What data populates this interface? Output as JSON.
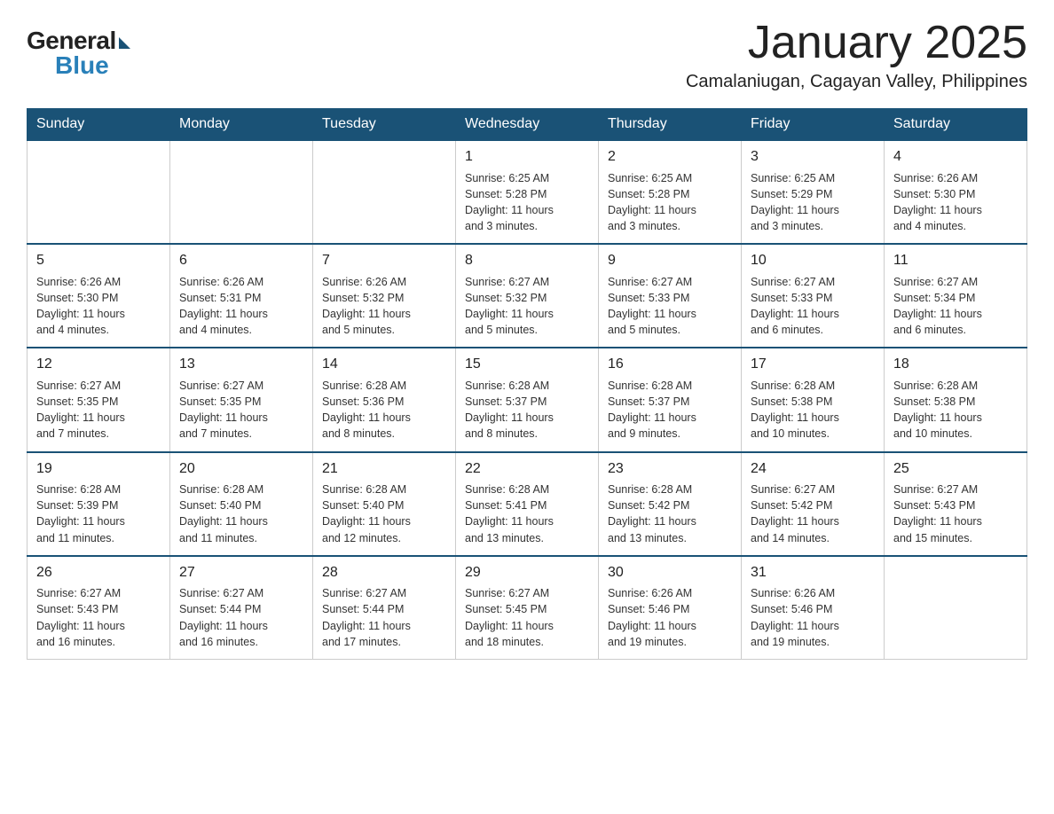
{
  "header": {
    "logo": {
      "general": "General",
      "blue": "Blue"
    },
    "title": "January 2025",
    "subtitle": "Camalaniugan, Cagayan Valley, Philippines"
  },
  "weekdays": [
    "Sunday",
    "Monday",
    "Tuesday",
    "Wednesday",
    "Thursday",
    "Friday",
    "Saturday"
  ],
  "weeks": [
    [
      {
        "day": "",
        "info": ""
      },
      {
        "day": "",
        "info": ""
      },
      {
        "day": "",
        "info": ""
      },
      {
        "day": "1",
        "info": "Sunrise: 6:25 AM\nSunset: 5:28 PM\nDaylight: 11 hours\nand 3 minutes."
      },
      {
        "day": "2",
        "info": "Sunrise: 6:25 AM\nSunset: 5:28 PM\nDaylight: 11 hours\nand 3 minutes."
      },
      {
        "day": "3",
        "info": "Sunrise: 6:25 AM\nSunset: 5:29 PM\nDaylight: 11 hours\nand 3 minutes."
      },
      {
        "day": "4",
        "info": "Sunrise: 6:26 AM\nSunset: 5:30 PM\nDaylight: 11 hours\nand 4 minutes."
      }
    ],
    [
      {
        "day": "5",
        "info": "Sunrise: 6:26 AM\nSunset: 5:30 PM\nDaylight: 11 hours\nand 4 minutes."
      },
      {
        "day": "6",
        "info": "Sunrise: 6:26 AM\nSunset: 5:31 PM\nDaylight: 11 hours\nand 4 minutes."
      },
      {
        "day": "7",
        "info": "Sunrise: 6:26 AM\nSunset: 5:32 PM\nDaylight: 11 hours\nand 5 minutes."
      },
      {
        "day": "8",
        "info": "Sunrise: 6:27 AM\nSunset: 5:32 PM\nDaylight: 11 hours\nand 5 minutes."
      },
      {
        "day": "9",
        "info": "Sunrise: 6:27 AM\nSunset: 5:33 PM\nDaylight: 11 hours\nand 5 minutes."
      },
      {
        "day": "10",
        "info": "Sunrise: 6:27 AM\nSunset: 5:33 PM\nDaylight: 11 hours\nand 6 minutes."
      },
      {
        "day": "11",
        "info": "Sunrise: 6:27 AM\nSunset: 5:34 PM\nDaylight: 11 hours\nand 6 minutes."
      }
    ],
    [
      {
        "day": "12",
        "info": "Sunrise: 6:27 AM\nSunset: 5:35 PM\nDaylight: 11 hours\nand 7 minutes."
      },
      {
        "day": "13",
        "info": "Sunrise: 6:27 AM\nSunset: 5:35 PM\nDaylight: 11 hours\nand 7 minutes."
      },
      {
        "day": "14",
        "info": "Sunrise: 6:28 AM\nSunset: 5:36 PM\nDaylight: 11 hours\nand 8 minutes."
      },
      {
        "day": "15",
        "info": "Sunrise: 6:28 AM\nSunset: 5:37 PM\nDaylight: 11 hours\nand 8 minutes."
      },
      {
        "day": "16",
        "info": "Sunrise: 6:28 AM\nSunset: 5:37 PM\nDaylight: 11 hours\nand 9 minutes."
      },
      {
        "day": "17",
        "info": "Sunrise: 6:28 AM\nSunset: 5:38 PM\nDaylight: 11 hours\nand 10 minutes."
      },
      {
        "day": "18",
        "info": "Sunrise: 6:28 AM\nSunset: 5:38 PM\nDaylight: 11 hours\nand 10 minutes."
      }
    ],
    [
      {
        "day": "19",
        "info": "Sunrise: 6:28 AM\nSunset: 5:39 PM\nDaylight: 11 hours\nand 11 minutes."
      },
      {
        "day": "20",
        "info": "Sunrise: 6:28 AM\nSunset: 5:40 PM\nDaylight: 11 hours\nand 11 minutes."
      },
      {
        "day": "21",
        "info": "Sunrise: 6:28 AM\nSunset: 5:40 PM\nDaylight: 11 hours\nand 12 minutes."
      },
      {
        "day": "22",
        "info": "Sunrise: 6:28 AM\nSunset: 5:41 PM\nDaylight: 11 hours\nand 13 minutes."
      },
      {
        "day": "23",
        "info": "Sunrise: 6:28 AM\nSunset: 5:42 PM\nDaylight: 11 hours\nand 13 minutes."
      },
      {
        "day": "24",
        "info": "Sunrise: 6:27 AM\nSunset: 5:42 PM\nDaylight: 11 hours\nand 14 minutes."
      },
      {
        "day": "25",
        "info": "Sunrise: 6:27 AM\nSunset: 5:43 PM\nDaylight: 11 hours\nand 15 minutes."
      }
    ],
    [
      {
        "day": "26",
        "info": "Sunrise: 6:27 AM\nSunset: 5:43 PM\nDaylight: 11 hours\nand 16 minutes."
      },
      {
        "day": "27",
        "info": "Sunrise: 6:27 AM\nSunset: 5:44 PM\nDaylight: 11 hours\nand 16 minutes."
      },
      {
        "day": "28",
        "info": "Sunrise: 6:27 AM\nSunset: 5:44 PM\nDaylight: 11 hours\nand 17 minutes."
      },
      {
        "day": "29",
        "info": "Sunrise: 6:27 AM\nSunset: 5:45 PM\nDaylight: 11 hours\nand 18 minutes."
      },
      {
        "day": "30",
        "info": "Sunrise: 6:26 AM\nSunset: 5:46 PM\nDaylight: 11 hours\nand 19 minutes."
      },
      {
        "day": "31",
        "info": "Sunrise: 6:26 AM\nSunset: 5:46 PM\nDaylight: 11 hours\nand 19 minutes."
      },
      {
        "day": "",
        "info": ""
      }
    ]
  ]
}
